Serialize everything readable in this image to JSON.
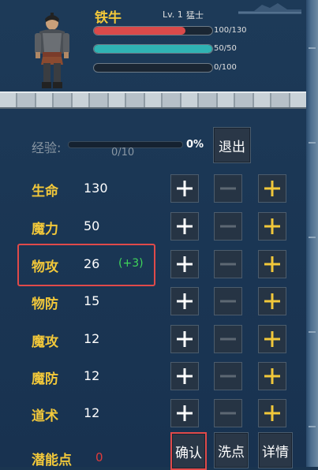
{
  "hero": {
    "name": "铁牛",
    "level": "Lv. 1",
    "class": "猛士",
    "bars": [
      {
        "name": "hp",
        "text": "100/130",
        "fraction": 0.77,
        "color": "#d94a4a"
      },
      {
        "name": "mp",
        "text": "50/50",
        "fraction": 1.0,
        "color": "#2fb3b3"
      },
      {
        "name": "extra",
        "text": "0/100",
        "fraction": 0.0,
        "color": "#777777"
      }
    ]
  },
  "exp": {
    "label": "经验:",
    "value": "0/10",
    "percent": "0%",
    "fraction": 0.0
  },
  "exit_label": "退出",
  "stats": [
    {
      "label": "生命",
      "value": "130",
      "bonus": ""
    },
    {
      "label": "魔力",
      "value": "50",
      "bonus": ""
    },
    {
      "label": "物攻",
      "value": "26",
      "bonus": "(+3)"
    },
    {
      "label": "物防",
      "value": "15",
      "bonus": ""
    },
    {
      "label": "魔攻",
      "value": "12",
      "bonus": ""
    },
    {
      "label": "魔防",
      "value": "12",
      "bonus": ""
    },
    {
      "label": "道术",
      "value": "12",
      "bonus": ""
    }
  ],
  "potential": {
    "label": "潜能点",
    "value": "0"
  },
  "buttons": {
    "confirm": "确认",
    "reset": "洗点",
    "detail": "详情"
  },
  "colors": {
    "gold": "#f2c83a",
    "bonus_green": "#3fd55a",
    "highlight_red": "#e04a4a"
  }
}
